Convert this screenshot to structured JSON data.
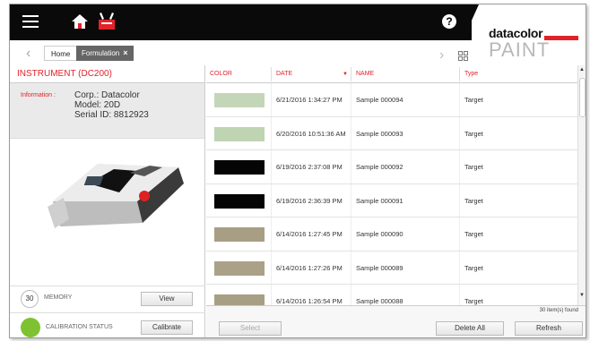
{
  "breadcrumb": {
    "home": "Home",
    "formulation": "Formulation",
    "close": "×"
  },
  "help": {
    "glyph": "?"
  },
  "brand": {
    "logo": "datacolor",
    "product": "PAINT",
    "accent": "#e2222a"
  },
  "instrument": {
    "title": "INSTRUMENT (DC200)",
    "info_label": "Information :",
    "corp": "Corp.: Datacolor",
    "model": "Model: 20D",
    "serial": "Serial ID: 8812923"
  },
  "memory": {
    "count": "30",
    "label": "MEMORY",
    "view_label": "View"
  },
  "calibration": {
    "label": "CALIBRATION STATUS",
    "button_label": "Calibrate",
    "status_color": "#7ec232"
  },
  "table": {
    "columns": {
      "color": "COLOR",
      "date": "DATE",
      "sort": "▼",
      "name": "NAME",
      "type": "Type"
    },
    "rows": [
      {
        "swatch": "#c4d6b8",
        "date": "6/21/2016 1:34:27 PM",
        "name": "Sample 000094",
        "type": "Target"
      },
      {
        "swatch": "#bfd4b2",
        "date": "6/20/2016 10:51:36 AM",
        "name": "Sample 000093",
        "type": "Target"
      },
      {
        "swatch": "#050505",
        "date": "6/19/2016 2:37:08 PM",
        "name": "Sample 000092",
        "type": "Target"
      },
      {
        "swatch": "#050505",
        "date": "6/19/2016 2:36:39 PM",
        "name": "Sample 000091",
        "type": "Target"
      },
      {
        "swatch": "#a79e84",
        "date": "6/14/2016 1:27:45 PM",
        "name": "Sample 000090",
        "type": "Target"
      },
      {
        "swatch": "#aaa188",
        "date": "6/14/2016 1:27:26 PM",
        "name": "Sample 000089",
        "type": "Target"
      },
      {
        "swatch": "#a79e84",
        "date": "6/14/2016 1:26:54 PM",
        "name": "Sample 000088",
        "type": "Target"
      }
    ],
    "found": "30 item(s) found"
  },
  "footer": {
    "select_label": "Select",
    "delete_all_label": "Delete All",
    "refresh_label": "Refresh"
  }
}
